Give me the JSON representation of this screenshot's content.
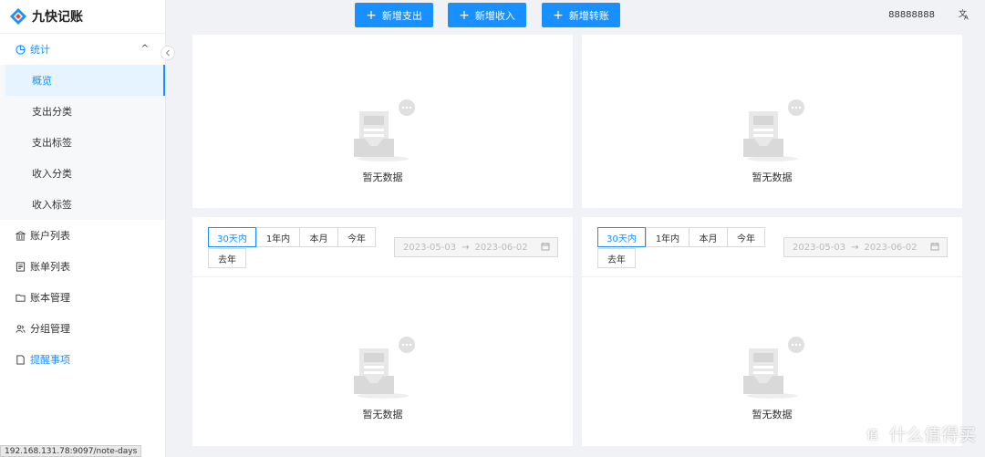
{
  "app": {
    "title": "九快记账"
  },
  "sidebar": {
    "stats_group": {
      "label": "统计"
    },
    "stats_items": [
      {
        "label": "概览"
      },
      {
        "label": "支出分类"
      },
      {
        "label": "支出标签"
      },
      {
        "label": "收入分类"
      },
      {
        "label": "收入标签"
      }
    ],
    "items": [
      {
        "label": "账户列表",
        "icon": "bank-icon"
      },
      {
        "label": "账单列表",
        "icon": "bill-icon"
      },
      {
        "label": "账本管理",
        "icon": "folder-icon"
      },
      {
        "label": "分组管理",
        "icon": "group-icon"
      },
      {
        "label": "提醒事项",
        "icon": "note-icon"
      }
    ]
  },
  "header": {
    "add_expense": "新增支出",
    "add_income": "新增收入",
    "add_transfer": "新增转账",
    "user": "88888888"
  },
  "panels": {
    "empty_text": "暂无数据",
    "ranges": [
      "30天内",
      "1年内",
      "本月",
      "今年",
      "去年"
    ],
    "date_start": "2023-05-03",
    "date_end": "2023-06-02"
  },
  "status_bar": {
    "url": "192.168.131.78:9097/note-days"
  },
  "watermark": {
    "text": "什么值得买"
  },
  "colors": {
    "accent": "#1890ff"
  }
}
